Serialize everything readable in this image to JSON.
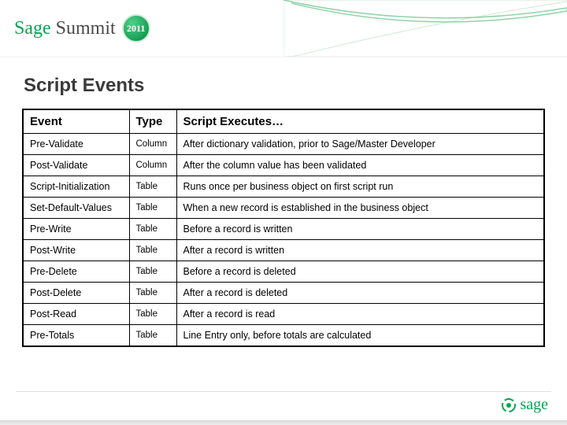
{
  "header": {
    "brand_sage": "Sage",
    "brand_summit": "Summit",
    "year": "2011"
  },
  "slide": {
    "title": "Script Events"
  },
  "table": {
    "headers": {
      "event": "Event",
      "type": "Type",
      "desc": "Script Executes…"
    },
    "rows": [
      {
        "event": "Pre-Validate",
        "type": "Column",
        "desc": "After dictionary validation, prior to Sage/Master Developer"
      },
      {
        "event": "Post-Validate",
        "type": "Column",
        "desc": "After the column value has been validated"
      },
      {
        "event": "Script-Initialization",
        "type": "Table",
        "desc": "Runs once per business object on first script run"
      },
      {
        "event": "Set-Default-Values",
        "type": "Table",
        "desc": "When a new record is established in the business object"
      },
      {
        "event": "Pre-Write",
        "type": "Table",
        "desc": "Before a record is written"
      },
      {
        "event": "Post-Write",
        "type": "Table",
        "desc": "After a record is written"
      },
      {
        "event": "Pre-Delete",
        "type": "Table",
        "desc": "Before a record is deleted"
      },
      {
        "event": "Post-Delete",
        "type": "Table",
        "desc": "After a record is deleted"
      },
      {
        "event": "Post-Read",
        "type": "Table",
        "desc": "After a record is read"
      },
      {
        "event": "Pre-Totals",
        "type": "Table",
        "desc": "Line Entry only, before totals are calculated"
      }
    ]
  },
  "footer": {
    "brand": "sage"
  }
}
